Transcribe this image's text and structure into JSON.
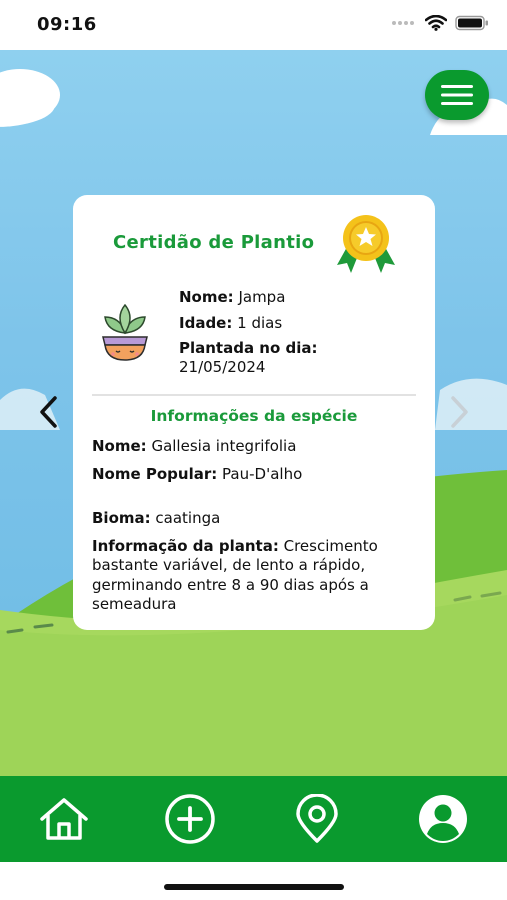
{
  "status_bar": {
    "time": "09:16"
  },
  "card": {
    "title": "Certidão de Plantio",
    "plant": {
      "name_label": "Nome:",
      "name_value": "Jampa",
      "age_label": "Idade:",
      "age_value": "1 dias",
      "planted_label": "Plantada no dia:",
      "planted_value": "21/05/2024"
    },
    "species_title": "Informações da espécie",
    "species": {
      "name_label": "Nome:",
      "name_value": "Gallesia integrifolia",
      "popular_label": "Nome Popular:",
      "popular_value": "Pau-D'alho",
      "biome_label": "Bioma:",
      "biome_value": "caatinga",
      "info_label": "Informação da planta:",
      "info_value": "Crescimento bastante variável, de lento a rápido, germinando entre 8 a 90 dias após a semeadura"
    }
  },
  "icons": {
    "menu": "hamburger-icon",
    "prev": "chevron-left-icon",
    "next": "chevron-right-icon",
    "home": "home-icon",
    "add": "plus-circle-icon",
    "location": "location-pin-icon",
    "profile": "user-icon"
  },
  "colors": {
    "primary_green": "#0a9a2e",
    "title_green": "#1a9a3a",
    "sky": "#7ec4ea",
    "grass": "#9fd45a"
  }
}
